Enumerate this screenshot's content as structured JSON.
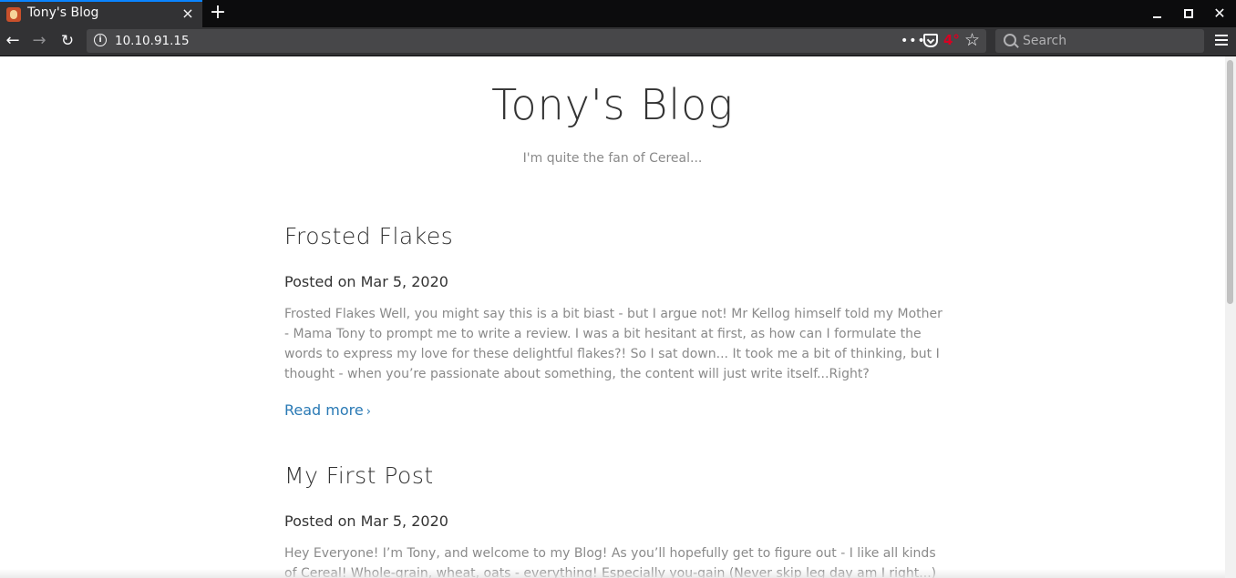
{
  "browser": {
    "tab": {
      "title": "Tony's Blog",
      "favicon": "tony-favicon-icon"
    },
    "url": "10.10.91.15",
    "weather": "4°",
    "search_placeholder": "Search",
    "icons": {
      "close": "×",
      "new_tab": "+",
      "back": "←",
      "forward": "→",
      "reload": "↻",
      "info": "i",
      "page_actions": "•••",
      "star": "☆",
      "window_close": "✕"
    },
    "colors": {
      "tab_accent": "#0a84ff",
      "chrome": "#323234",
      "weather": "#d70022"
    }
  },
  "site": {
    "title": "Tony's Blog",
    "tagline": "I'm quite the fan of Cereal..."
  },
  "posts": [
    {
      "title": "Frosted Flakes",
      "date": "Posted on Mar 5, 2020",
      "excerpt": "Frosted Flakes Well, you might say this is a bit biast - but I argue not! Mr Kellog himself told my Mother - Mama Tony to prompt me to write a review. I was a bit hesitant at first, as how can I formulate the words to express my love for these delightful flakes?! So I sat down... It took me a bit of thinking, but I thought - when you’re passionate about something, the content will just write itself...Right?",
      "read_more": "Read more",
      "chevron": "›"
    },
    {
      "title": "My First Post",
      "date": "Posted on Mar 5, 2020",
      "excerpt": "Hey Everyone! I’m Tony, and welcome to my Blog! As you’ll hopefully get to figure out - I like all kinds of Cereal! Whole-grain, wheat, oats - everything! Especially you-gain (Never skip leg day am I right...)"
    }
  ],
  "colors": {
    "link": "#2a7ab5",
    "muted_text": "#8a8a8a",
    "heading": "#333333"
  }
}
